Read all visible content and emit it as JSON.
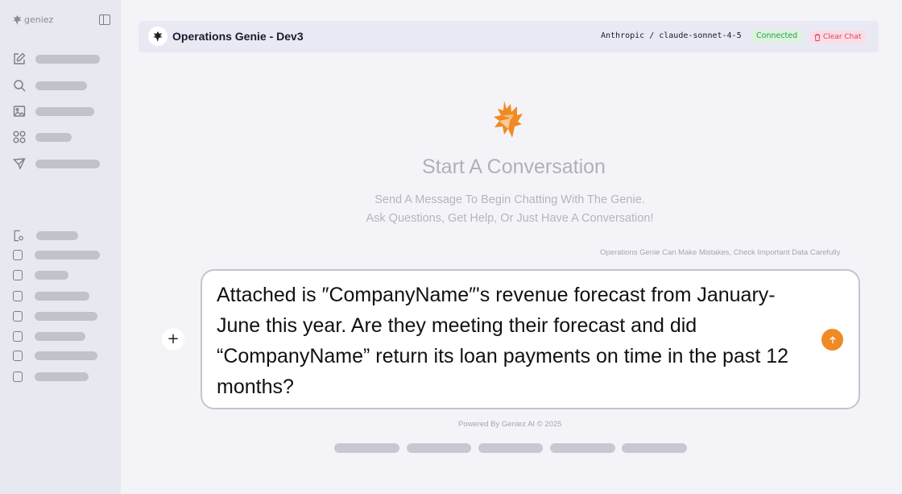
{
  "sidebar": {
    "brand": "geniez",
    "nav_icons": [
      "edit-icon",
      "search-icon",
      "image-icon",
      "apps-icon",
      "send-icon"
    ],
    "list_icons": [
      "document-settings-icon",
      "checkbox-icon",
      "checkbox-icon",
      "checkbox-icon",
      "checkbox-icon",
      "checkbox-icon",
      "checkbox-icon",
      "checkbox-icon"
    ]
  },
  "header": {
    "title": "Operations Genie - Dev3",
    "model": "Anthropic / claude-sonnet-4-5",
    "status": "Connected",
    "clear_label": "Clear Chat"
  },
  "empty_state": {
    "title": "Start A Conversation",
    "subtitle_line1": "Send A Message To Begin Chatting With The Genie.",
    "subtitle_line2": "Ask Questions, Get Help, Or Just Have A Conversation!"
  },
  "composer": {
    "disclaimer": "Operations Genie Can Make Mistakes, Check Important Data Carefully",
    "message": "Attached is ″CompanyName″'s revenue forecast from January-June this year. Are they meeting their forecast and did “CompanyName” return its loan payments on time in the past 12 months?",
    "add_label": "+"
  },
  "footer": {
    "powered": "Powered By Geniez AI © 2025"
  },
  "colors": {
    "accent": "#f08a24",
    "status_green": "#24a244",
    "danger": "#e13d6b"
  }
}
